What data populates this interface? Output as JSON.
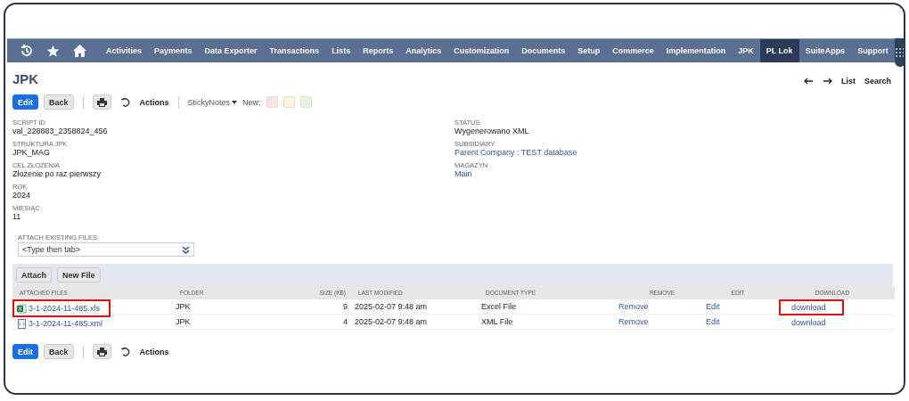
{
  "navbar": {
    "items": [
      {
        "label": "Activities",
        "selected": false
      },
      {
        "label": "Payments",
        "selected": false
      },
      {
        "label": "Data Exporter",
        "selected": false
      },
      {
        "label": "Transactions",
        "selected": false
      },
      {
        "label": "Lists",
        "selected": false
      },
      {
        "label": "Reports",
        "selected": false
      },
      {
        "label": "Analytics",
        "selected": false
      },
      {
        "label": "Customization",
        "selected": false
      },
      {
        "label": "Documents",
        "selected": false
      },
      {
        "label": "Setup",
        "selected": false
      },
      {
        "label": "Commerce",
        "selected": false
      },
      {
        "label": "Implementation",
        "selected": false
      },
      {
        "label": "JPK",
        "selected": false
      },
      {
        "label": "PL Lok",
        "selected": true
      },
      {
        "label": "SuiteApps",
        "selected": false
      },
      {
        "label": "Support",
        "selected": false
      }
    ]
  },
  "page": {
    "title": "JPK",
    "nav_links": [
      "List",
      "Search"
    ]
  },
  "toolbar": {
    "edit": "Edit",
    "back": "Back",
    "actions": "Actions",
    "sticky_notes": "StickyNotes",
    "new_label": "New:",
    "note_colors": [
      {
        "color": "#fde2e2"
      },
      {
        "color": "#fdf3d6"
      },
      {
        "color": "#e2f5dc"
      }
    ]
  },
  "fields_left": [
    {
      "label": "SCRIPT ID",
      "value": "val_228883_2358824_456",
      "link": false
    },
    {
      "label": "STRUKTURA JPK",
      "value": "JPK_MAG",
      "link": false
    },
    {
      "label": "CEL ZŁOŻENIA",
      "value": "Złożenie po raz pierwszy",
      "link": false
    },
    {
      "label": "ROK",
      "value": "2024",
      "link": false
    },
    {
      "label": "MIESIĄC",
      "value": "11",
      "link": false
    }
  ],
  "fields_right": [
    {
      "label": "STATUS",
      "value": "Wygenerowano XML",
      "link": false
    },
    {
      "label": "SUBSIDIARY",
      "value": "Parent Company : TEST database",
      "link": true
    },
    {
      "label": "MAGAZYN",
      "value": "Main",
      "link": true
    }
  ],
  "attach_existing": {
    "label": "ATTACH EXISTING FILES",
    "placeholder": "<Type then tab>"
  },
  "files": {
    "buttons": [
      "Attach",
      "New File"
    ],
    "columns": [
      "ATTACHED FILES",
      "FOLDER",
      "SIZE (KB)",
      "LAST MODIFIED",
      "DOCUMENT TYPE",
      "REMOVE",
      "EDIT",
      "DOWNLOAD"
    ],
    "rows": [
      {
        "kind": "excel",
        "name": "3-1-2024-11-485.xls",
        "folder": "JPK",
        "size": "9",
        "modified": "2025-02-07 9:48 am",
        "doc_type": "Excel File",
        "remove": "Remove",
        "edit": "Edit",
        "download": "download",
        "highlighted": true
      },
      {
        "kind": "xml",
        "name": "3-1-2024-11-485.xml",
        "folder": "JPK",
        "size": "4",
        "modified": "2025-02-07 9:48 am",
        "doc_type": "XML File",
        "remove": "Remove",
        "edit": "Edit",
        "download": "download",
        "highlighted": false
      }
    ]
  },
  "bottom_toolbar": {
    "edit": "Edit",
    "back": "Back",
    "actions": "Actions"
  }
}
